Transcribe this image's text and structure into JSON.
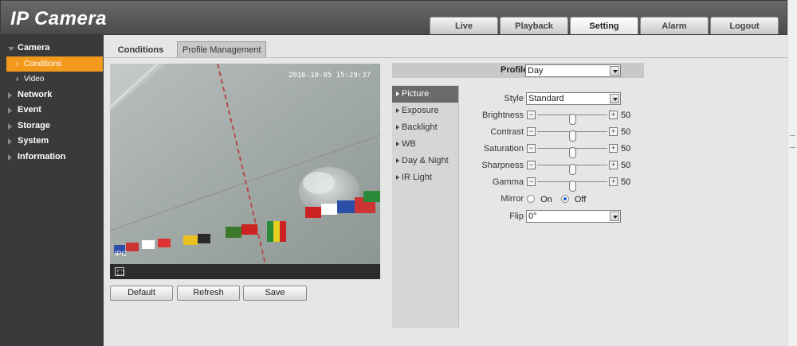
{
  "app": {
    "title": "IP Camera"
  },
  "topnav": [
    "Live",
    "Playback",
    "Setting",
    "Alarm",
    "Logout"
  ],
  "sidebar": {
    "camera": "Camera",
    "conditions": "Conditions",
    "video": "Video",
    "network": "Network",
    "event": "Event",
    "storage": "Storage",
    "system": "System",
    "information": "Information"
  },
  "tabs": {
    "conditions": "Conditions",
    "profile_mgmt": "Profile Management"
  },
  "video": {
    "timestamp": "2016-10-05 15:29:37",
    "channel": "IPC"
  },
  "buttons": {
    "default": "Default",
    "refresh": "Refresh",
    "save": "Save"
  },
  "profile": {
    "label": "Profile",
    "value": "Day"
  },
  "menu": [
    "Picture",
    "Exposure",
    "Backlight",
    "WB",
    "Day & Night",
    "IR Light"
  ],
  "settings": {
    "style_label": "Style",
    "style_value": "Standard",
    "brightness_label": "Brightness",
    "brightness": 50,
    "contrast_label": "Contrast",
    "contrast": 50,
    "saturation_label": "Saturation",
    "saturation": 50,
    "sharpness_label": "Sharpness",
    "sharpness": 50,
    "gamma_label": "Gamma",
    "gamma": 50,
    "mirror_label": "Mirror",
    "mirror_on": "On",
    "mirror_off": "Off",
    "mirror_value": "Off",
    "flip_label": "Flip",
    "flip_value": "0°"
  },
  "colors": {
    "accent": "#f39a1c",
    "header": "#555555",
    "sidebar": "#3a3a3a"
  },
  "icons": {
    "fullscreen": "fullscreen-icon"
  }
}
